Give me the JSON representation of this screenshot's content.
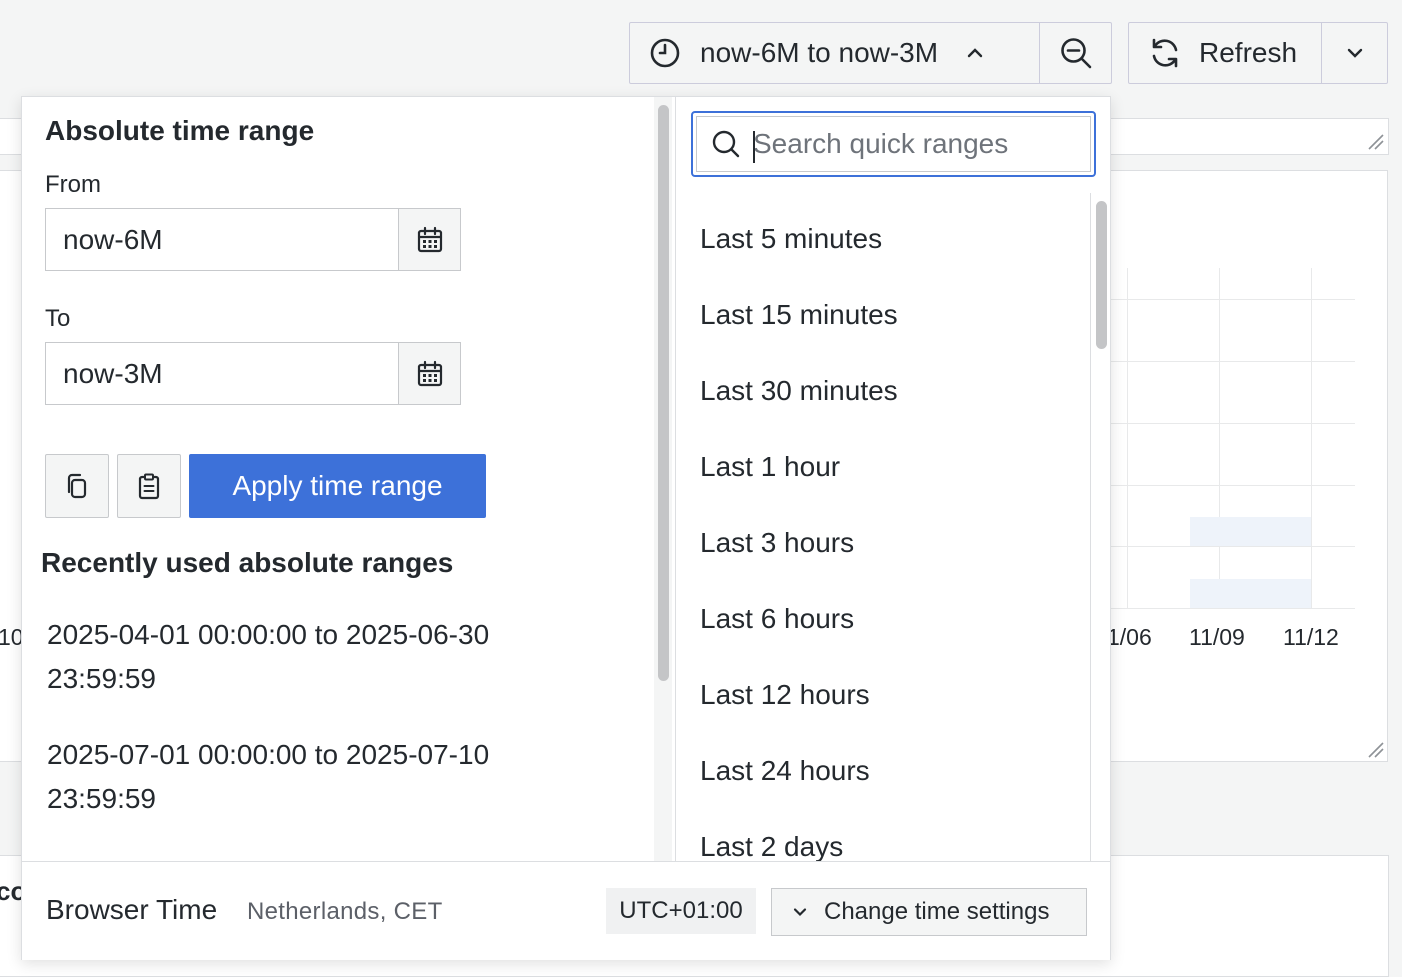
{
  "toolbar": {
    "time_range_label": "now-6M to now-3M",
    "refresh_label": "Refresh"
  },
  "background": {
    "x_ticks": [
      "10",
      "1/06",
      "11/09",
      "11/12"
    ],
    "partial_text": "co"
  },
  "picker": {
    "absolute": {
      "title": "Absolute time range",
      "from_label": "From",
      "from_value": "now-6M",
      "to_label": "To",
      "to_value": "now-3M",
      "apply_label": "Apply time range"
    },
    "recent": {
      "title": "Recently used absolute ranges",
      "items": [
        {
          "line1": "2025-04-01 00:00:00 to 2025-06-30",
          "line2": "23:59:59"
        },
        {
          "line1": "2025-07-01 00:00:00 to 2025-07-10",
          "line2": "23:59:59"
        }
      ]
    },
    "search": {
      "placeholder": "Search quick ranges"
    },
    "quick_ranges": [
      "Last 5 minutes",
      "Last 15 minutes",
      "Last 30 minutes",
      "Last 1 hour",
      "Last 3 hours",
      "Last 6 hours",
      "Last 12 hours",
      "Last 24 hours",
      "Last 2 days"
    ],
    "footer": {
      "browser_time_label": "Browser Time",
      "zone": "Netherlands, CET",
      "utc_offset": "UTC+01:00",
      "change_settings_label": "Change time settings"
    }
  },
  "icons": {
    "time_range": "clock-icon",
    "zoom": "zoom-out-icon",
    "refresh": "refresh-icon",
    "dropdown": "chevron-down-icon",
    "calendar": "calendar-icon",
    "copy": "copy-icon",
    "paste": "clipboard-icon",
    "search": "search-icon"
  },
  "colors": {
    "accent": "#3d71d9",
    "background": "#f4f5f5",
    "panel": "#ffffff",
    "text": "#24292e",
    "muted": "#5c6068"
  }
}
